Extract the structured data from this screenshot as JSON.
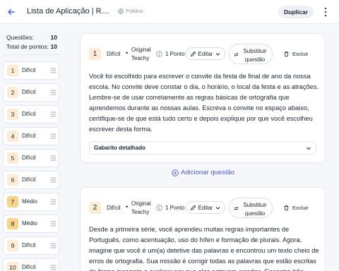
{
  "header": {
    "title": "Lista de Aplicação | Regras de Ortografia",
    "visibility": "Público",
    "duplicate_label": "Duplicar"
  },
  "stats": {
    "questions_label": "Questões:",
    "questions_value": "10",
    "points_label": "Total de pontos:",
    "points_value": "10"
  },
  "nav": [
    {
      "num": "1",
      "level": "Difícil"
    },
    {
      "num": "2",
      "level": "Difícil"
    },
    {
      "num": "3",
      "level": "Difícil"
    },
    {
      "num": "4",
      "level": "Difícil"
    },
    {
      "num": "5",
      "level": "Difícil"
    },
    {
      "num": "6",
      "level": "Difícil"
    },
    {
      "num": "7",
      "level": "Médio"
    },
    {
      "num": "8",
      "level": "Médio"
    },
    {
      "num": "9",
      "level": "Difícil"
    },
    {
      "num": "10",
      "level": "Difícil"
    }
  ],
  "questions": [
    {
      "num": "1",
      "level": "Difícil",
      "origin": "Original Teachy",
      "points": "1 Ponto",
      "edit_label": "Editar",
      "replace_label": "Substituir questão",
      "delete_label": "Excluir",
      "text": "Você foi escolhido para escrever o convite da festa de final de ano da nossa escola. No convite deve constar o dia, o horário, o local da festa e as atrações. Lembre-se de usar corretamente as regras básicas de ortografia que aprendemos durante as nossas aulas. Escreva o convite no espaço abaixo, certifique-se de que está tudo certo e depois explique por que você escolheu escrever desta forma.",
      "answer_label": "Gabarito detalhado"
    },
    {
      "num": "2",
      "level": "Difícil",
      "origin": "Original Teachy",
      "points": "1 Ponto",
      "edit_label": "Editar",
      "replace_label": "Substituir questão",
      "delete_label": "Excluir",
      "text": "Desde a primeira série, você aprendeu muitas regras importantes de Português, como acentuação, uso do hífen e formação de plurais. Agora, imagine que você é um(a) detetive das palavras e encontrou um texto cheio de erros de ortografia. Sua missão é corrigir todas as palavras que estão escritas de forma incorreta e explicar por que elas estavam erradas. Encontre três"
    }
  ],
  "add_question_label": "Adicionar questão",
  "colors": {
    "accent": "#4a5bd8",
    "difficult_badge": "#fdebd3",
    "medium_badge": "#f7d488"
  }
}
